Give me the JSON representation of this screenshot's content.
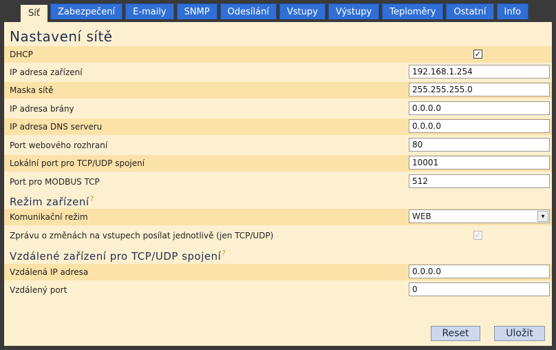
{
  "tabs": [
    "Síť",
    "Zabezpečení",
    "E-maily",
    "SNMP",
    "Odesílání",
    "Vstupy",
    "Výstupy",
    "Teploměry",
    "Ostatní",
    "Info"
  ],
  "title": "Nastavení sítě",
  "network": {
    "dhcp_label": "DHCP",
    "dhcp_checked": true,
    "ip_label": "IP adresa zařízení",
    "ip_value": "192.168.1.254",
    "mask_label": "Maska sítě",
    "mask_value": "255.255.255.0",
    "gateway_label": "IP adresa brány",
    "gateway_value": "0.0.0.0",
    "dns_label": "IP adresa DNS serveru",
    "dns_value": "0.0.0.0",
    "webport_label": "Port webového rozhraní",
    "webport_value": "80",
    "localport_label": "Lokální port pro TCP/UDP spojení",
    "localport_value": "10001",
    "modbus_label": "Port pro MODBUS TCP",
    "modbus_value": "512"
  },
  "mode": {
    "heading": "Režim zařízení",
    "help": "?",
    "comm_label": "Komunikační režim",
    "comm_value": "WEB",
    "separate_label": "Zprávu o změnách na vstupech posílat jednotlivě (jen TCP/UDP)",
    "separate_checked": true
  },
  "remote": {
    "heading": "Vzdálené zařízení pro TCP/UDP spojení",
    "help": "?",
    "ip_label": "Vzdálená IP adresa",
    "ip_value": "0.0.0.0",
    "port_label": "Vzdálený port",
    "port_value": "0"
  },
  "buttons": {
    "reset": "Reset",
    "save": "Uložit"
  },
  "icons": {
    "checkbox": "check-icon",
    "dropdown": "chevron-down-icon"
  },
  "colors": {
    "tab": "#2f6fd6",
    "panel": "#fdf0d0",
    "row_alt": "#fbe2a8",
    "button": "#cdd8ec"
  }
}
